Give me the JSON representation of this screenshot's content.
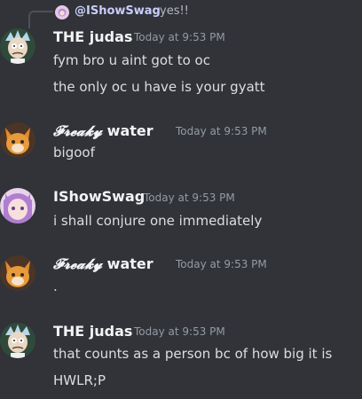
{
  "reply": {
    "username": "@IShowSwag",
    "text": "yes!!",
    "avatar_icon": "anime-girl-avatar-icon"
  },
  "messages": [
    {
      "author": "THE judas",
      "timestamp": "Today at 9:53 PM",
      "avatar_icon": "rick-avatar-icon",
      "lines": [
        "fym bro u aint got to oc",
        "the only oc u have is your gyatt"
      ]
    },
    {
      "author_stylized": "𝓕𝓻𝓮𝓪𝓴𝔂",
      "author_plain": "water",
      "timestamp": "Today at 9:53 PM",
      "avatar_icon": "orange-fox-avatar-icon",
      "lines": [
        "bigoof"
      ]
    },
    {
      "author": "IShowSwag",
      "timestamp": "Today at 9:53 PM",
      "avatar_icon": "anime-girl-avatar-icon",
      "lines": [
        "i shall conjure one immediately"
      ]
    },
    {
      "author_stylized": "𝓕𝓻𝓮𝓪𝓴𝔂",
      "author_plain": "water",
      "timestamp": "Today at 9:53 PM",
      "avatar_icon": "orange-fox-avatar-icon",
      "lines": [
        "."
      ]
    },
    {
      "author": "THE judas",
      "timestamp": "Today at 9:53 PM",
      "avatar_icon": "rick-avatar-icon",
      "lines": [
        "that counts as a person bc of how big it is",
        "HWLR;P"
      ]
    }
  ],
  "colors": {
    "background": "#313338",
    "username": "#f2f3f5",
    "text": "#dbdee1",
    "timestamp": "#949ba4",
    "reply_name": "#c9cdfb"
  }
}
